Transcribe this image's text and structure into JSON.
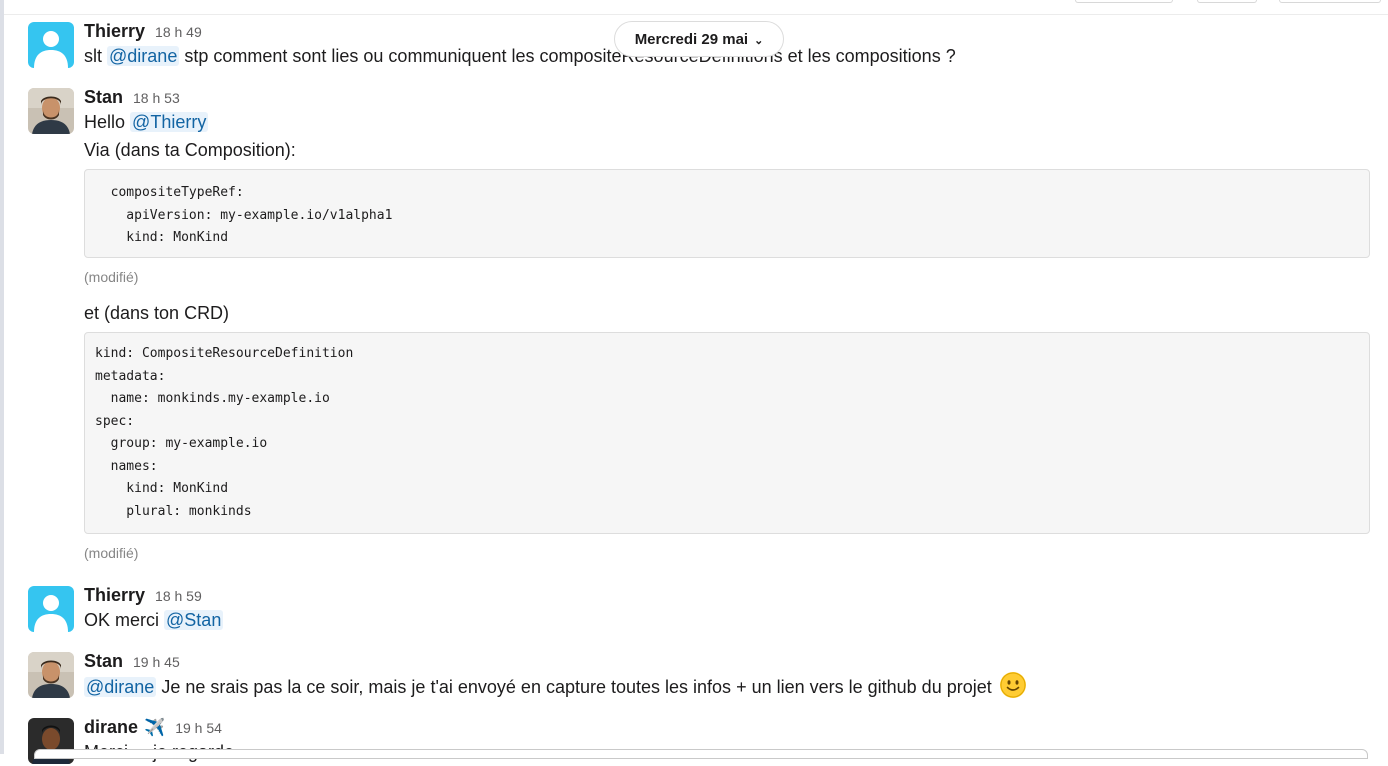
{
  "date_divider": {
    "label": "Mercredi 29 mai"
  },
  "messages": [
    {
      "author": "Thierry",
      "time": "18 h 49",
      "text_before": "slt",
      "mention": "@dirane",
      "text_after": "stp comment sont lies ou communiquent les compositeResourceDefinitions et les compositions ?"
    },
    {
      "author": "Stan",
      "time": "18 h 53",
      "greeting": "Hello",
      "mention": "@Thierry",
      "line2": "Via (dans ta Composition):",
      "code1": "  compositeTypeRef:\n    apiVersion: my-example.io/v1alpha1\n    kind: MonKind",
      "edited1": "(modifié)",
      "line3": "et (dans ton CRD)",
      "code2": "kind: CompositeResourceDefinition\nmetadata:\n  name: monkinds.my-example.io\nspec:\n  group: my-example.io\n  names:\n    kind: MonKind\n    plural: monkinds",
      "edited2": "(modifié)"
    },
    {
      "author": "Thierry",
      "time": "18 h 59",
      "text_before": "OK merci",
      "mention": "@Stan"
    },
    {
      "author": "Stan",
      "time": "19 h 45",
      "mention": "@dirane",
      "text_after": "Je ne srais pas la ce soir, mais je t'ai envoyé en capture toutes les infos + un lien vers le github du projet",
      "emoji": "slightly-smiling-face-icon"
    },
    {
      "author": "dirane",
      "status_emoji": "✈️",
      "time": "19 h 54",
      "text": "Merci ... je regarde"
    }
  ],
  "colors": {
    "mention_bg": "#e8f2fb",
    "mention_text": "#1264a3",
    "default_avatar": "#35c5f0"
  }
}
